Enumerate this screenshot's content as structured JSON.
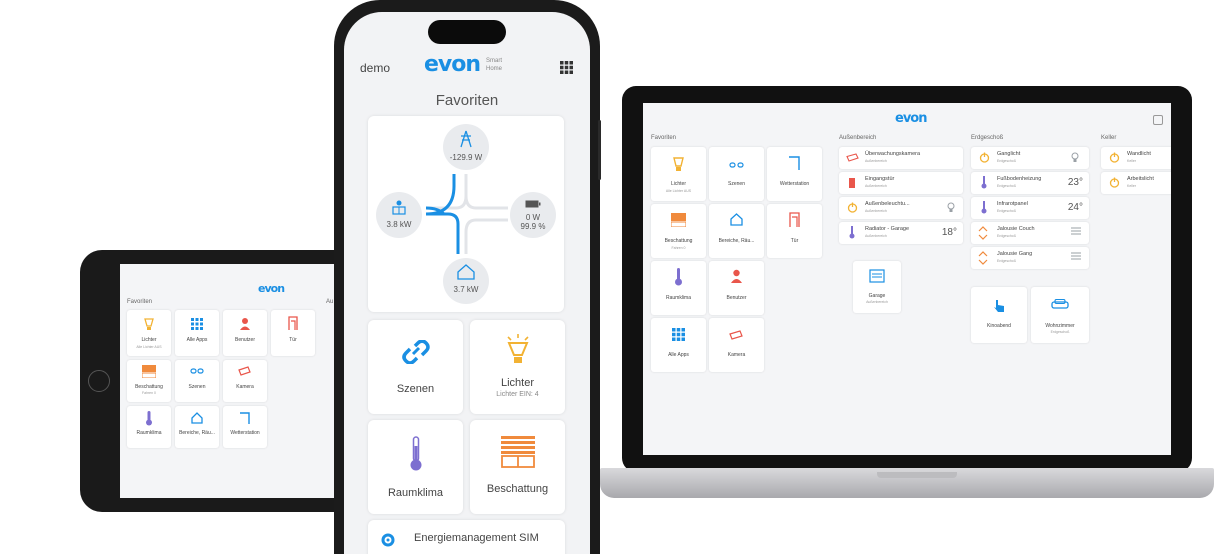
{
  "tablet": {
    "brand": "evon",
    "section_favorites": "Favoriten",
    "section_partial": "Au",
    "tiles": [
      {
        "label": "Lichter",
        "sub": "Alle Lichter AUS"
      },
      {
        "label": "Alle Apps",
        "sub": ""
      },
      {
        "label": "Benutzer",
        "sub": ""
      },
      {
        "label": "Tür",
        "sub": ""
      },
      {
        "label": "Beschattung",
        "sub": "Fahren 0"
      },
      {
        "label": "Szenen",
        "sub": ""
      },
      {
        "label": "Kamera",
        "sub": ""
      },
      {
        "label": "Raumklima",
        "sub": ""
      },
      {
        "label": "Bereiche, Räu...",
        "sub": ""
      },
      {
        "label": "Wetterstation",
        "sub": ""
      }
    ]
  },
  "phone": {
    "user": "demo",
    "brand": "evon",
    "brand_tag_1": "Smart",
    "brand_tag_2": "Home",
    "title": "Favoriten",
    "energy": {
      "grid": "-129.9 W",
      "solar": "3.8 kW",
      "battery_power": "0 W",
      "battery_level": "99.9 %",
      "house": "3.7 kW"
    },
    "tiles": [
      {
        "label": "Szenen",
        "sub": ""
      },
      {
        "label": "Lichter",
        "sub": "Lichter EIN: 4"
      },
      {
        "label": "Raumklima",
        "sub": ""
      },
      {
        "label": "Beschattung",
        "sub": ""
      }
    ],
    "bottom_label": "Energiemanagement SIM"
  },
  "laptop": {
    "brand": "evon",
    "sections": {
      "favorites": "Favoriten",
      "outdoor": "Außenbereich",
      "ground": "Erdgeschoß",
      "cellar": "Keller"
    },
    "fav_tiles": [
      {
        "label": "Lichter",
        "sub": "Alle Lichter AUS"
      },
      {
        "label": "Szenen",
        "sub": ""
      },
      {
        "label": "Wetterstation",
        "sub": ""
      },
      {
        "label": "Beschattung",
        "sub": "Fahren 0"
      },
      {
        "label": "Bereiche, Räu...",
        "sub": ""
      },
      {
        "label": "Tür",
        "sub": ""
      },
      {
        "label": "Raumklima",
        "sub": ""
      },
      {
        "label": "Benutzer",
        "sub": ""
      },
      {
        "label": "Alle Apps",
        "sub": ""
      },
      {
        "label": "Kamera",
        "sub": ""
      }
    ],
    "outdoor_rows": [
      {
        "name": "Überwachungskamera",
        "room": "Außenbereich",
        "value": ""
      },
      {
        "name": "Eingangstür",
        "room": "Außenbereich",
        "value": ""
      },
      {
        "name": "Außenbeleuchtu...",
        "room": "Außenbereich",
        "value": ""
      },
      {
        "name": "Radiator - Garage",
        "room": "Außenbereich",
        "value": "18°"
      }
    ],
    "garage": {
      "label": "Garage",
      "sub": "Außenbereich"
    },
    "ground_rows": [
      {
        "name": "Ganglicht",
        "room": "Erdgeschoß",
        "value": ""
      },
      {
        "name": "Fußbodenheizung",
        "room": "Erdgeschoß",
        "value": "23°"
      },
      {
        "name": "Infrarotpanel",
        "room": "Erdgeschoß",
        "value": "24°"
      },
      {
        "name": "Jalousie Couch",
        "room": "Erdgeschoß",
        "value": ""
      },
      {
        "name": "Jalousie Gang",
        "room": "Erdgeschoß",
        "value": ""
      }
    ],
    "ground_tiles": [
      {
        "label": "Kinoabend",
        "sub": ""
      },
      {
        "label": "Wohnzimmer",
        "sub": "Erdgeschoß"
      }
    ],
    "cellar_rows": [
      {
        "name": "Wandlicht",
        "room": "Keller"
      },
      {
        "name": "Arbeitslicht",
        "room": "Keller"
      }
    ]
  },
  "colors": {
    "accent": "#1a8fe3",
    "orange": "#f08a3c",
    "purple": "#7d6fd0",
    "red": "#e9564b",
    "yellow": "#f2b233",
    "gray": "#9aa0a6"
  }
}
